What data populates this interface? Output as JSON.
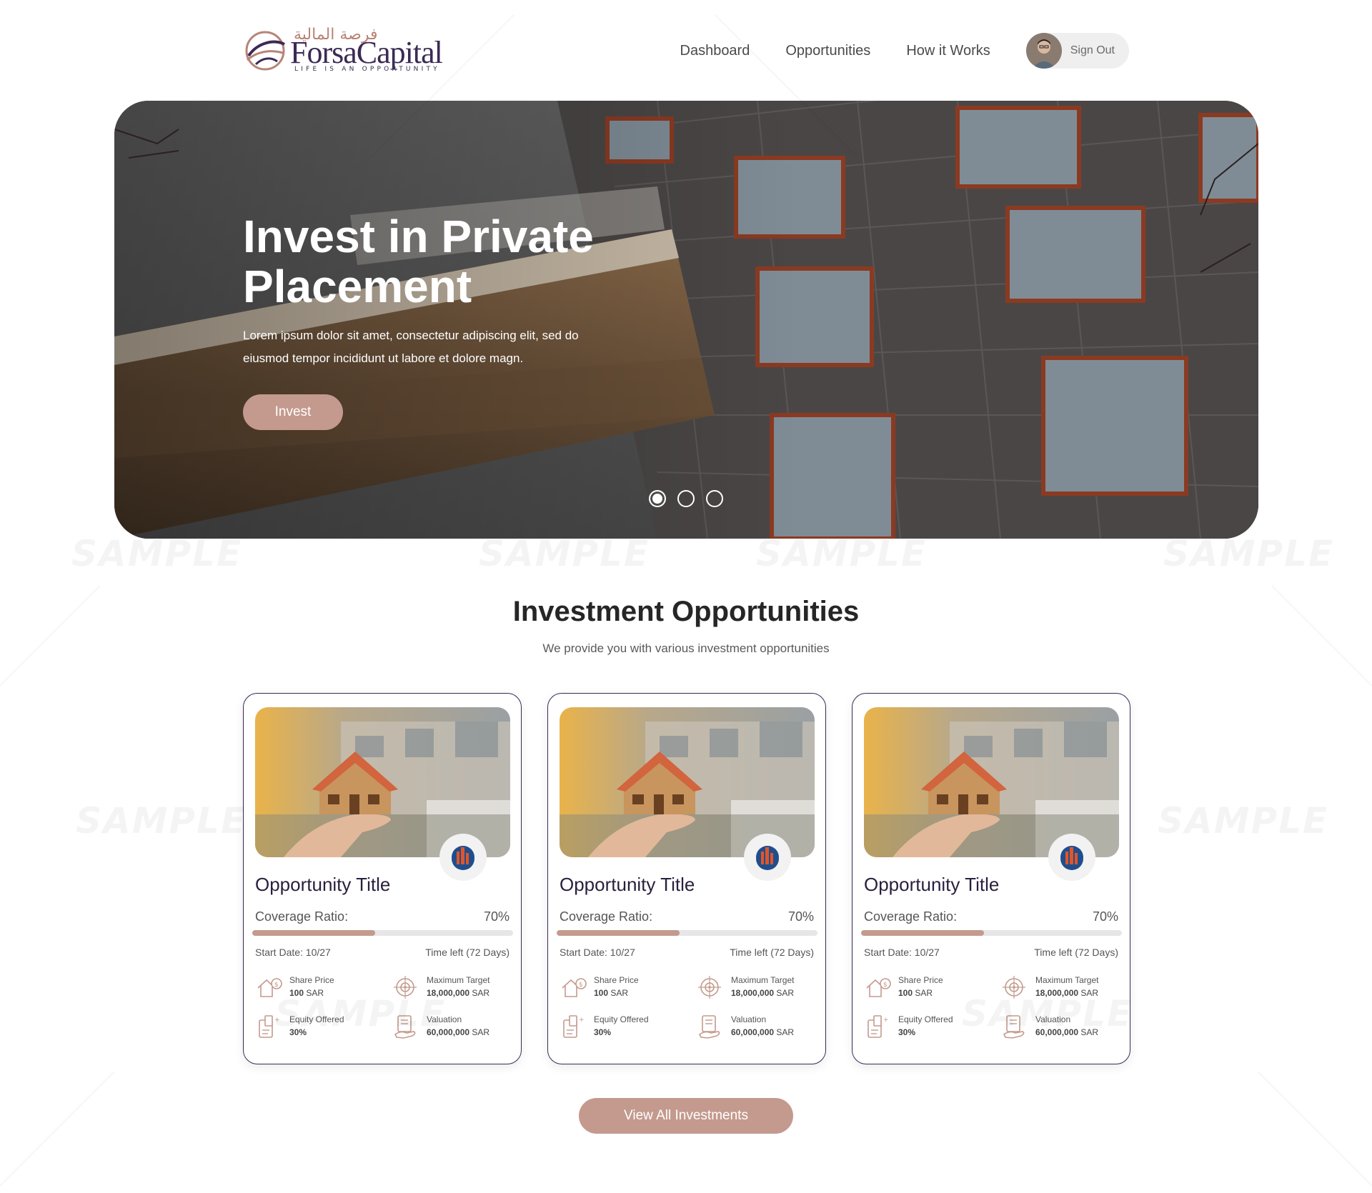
{
  "brand": {
    "arabic_name": "فرصة المالية",
    "name": "ForsaCapital",
    "tagline": "LIFE IS AN OPPORTUNITY"
  },
  "nav": {
    "items": [
      {
        "label": "Dashboard"
      },
      {
        "label": "Opportunities"
      },
      {
        "label": "How it Works"
      }
    ],
    "signout_label": "Sign Out"
  },
  "hero": {
    "title": "Invest in Private Placement",
    "text": "Lorem ipsum dolor sit amet, consectetur adipiscing elit, sed do eiusmod tempor incididunt ut labore et dolore magn.",
    "button_label": "Invest",
    "slides": 3,
    "active_slide": 1
  },
  "section": {
    "title": "Investment Opportunities",
    "subtitle": "We provide you with various investment opportunities"
  },
  "cards": [
    {
      "title": "Opportunity Title",
      "coverage_label": "Coverage Ratio:",
      "coverage_value": "70%",
      "coverage_fill": 0.47,
      "start_date": "Start Date: 10/27",
      "time_left": "Time left (72 Days)",
      "share_price_label": "Share Price",
      "share_price_value": "100",
      "max_target_label": "Maximum Target",
      "max_target_value": "18,000,000",
      "equity_label": "Equity Offered",
      "equity_value": "30%",
      "valuation_label": "Valuation",
      "valuation_value": "60,000,000",
      "currency": "SAR"
    },
    {
      "title": "Opportunity Title",
      "coverage_label": "Coverage Ratio:",
      "coverage_value": "70%",
      "coverage_fill": 0.47,
      "start_date": "Start Date: 10/27",
      "time_left": "Time left (72 Days)",
      "share_price_label": "Share Price",
      "share_price_value": "100",
      "max_target_label": "Maximum Target",
      "max_target_value": "18,000,000",
      "equity_label": "Equity Offered",
      "equity_value": "30%",
      "valuation_label": "Valuation",
      "valuation_value": "60,000,000",
      "currency": "SAR"
    },
    {
      "title": "Opportunity Title",
      "coverage_label": "Coverage Ratio:",
      "coverage_value": "70%",
      "coverage_fill": 0.47,
      "start_date": "Start Date: 10/27",
      "time_left": "Time left (72 Days)",
      "share_price_label": "Share Price",
      "share_price_value": "100",
      "max_target_label": "Maximum Target",
      "max_target_value": "18,000,000",
      "equity_label": "Equity Offered",
      "equity_value": "30%",
      "valuation_label": "Valuation",
      "valuation_value": "60,000,000",
      "currency": "SAR"
    }
  ],
  "view_all_label": "View All Investments",
  "watermark": "SAMPLE",
  "colors": {
    "accent": "#c49a8e",
    "brand_purple": "#3b2a55",
    "badge_orange": "#e0552b",
    "badge_blue": "#1f4e8c"
  }
}
